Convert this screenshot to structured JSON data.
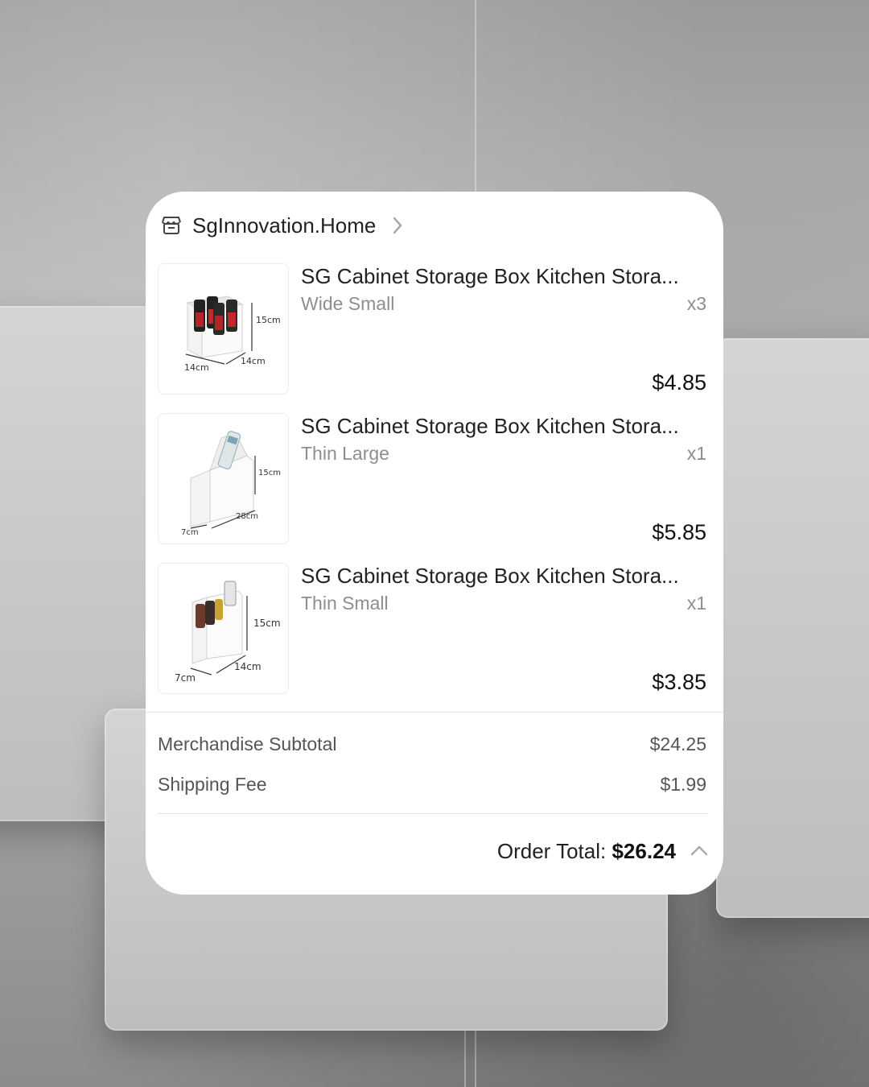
{
  "shop": {
    "icon": "storefront-icon",
    "name": "SgInnovation.Home",
    "chevron": "chevron-right-icon"
  },
  "items": [
    {
      "title": "SG Cabinet Storage Box Kitchen Stora...",
      "variant": "Wide Small",
      "qty": "x3",
      "price": "$4.85",
      "image": "product-image-wide-small",
      "dims": [
        "15cm",
        "14cm",
        "14cm"
      ]
    },
    {
      "title": "SG Cabinet Storage Box Kitchen Stora...",
      "variant": "Thin Large",
      "qty": "x1",
      "price": "$5.85",
      "image": "product-image-thin-large",
      "dims": [
        "15cm",
        "28cm",
        "7cm"
      ]
    },
    {
      "title": "SG Cabinet Storage Box Kitchen Stora...",
      "variant": "Thin Small",
      "qty": "x1",
      "price": "$3.85",
      "image": "product-image-thin-small",
      "dims": [
        "15cm",
        "14cm",
        "7cm"
      ]
    }
  ],
  "summary": {
    "subtotal_label": "Merchandise Subtotal",
    "subtotal_value": "$24.25",
    "shipping_label": "Shipping Fee",
    "shipping_value": "$1.99"
  },
  "total": {
    "label": "Order Total: ",
    "value": "$26.24",
    "chevron": "chevron-up-icon"
  },
  "colors": {
    "card_bg": "#ffffff",
    "text_primary": "#222222",
    "text_secondary": "#8e8e8e",
    "divider": "#e3e3e3",
    "background": "#a8a8a8"
  }
}
